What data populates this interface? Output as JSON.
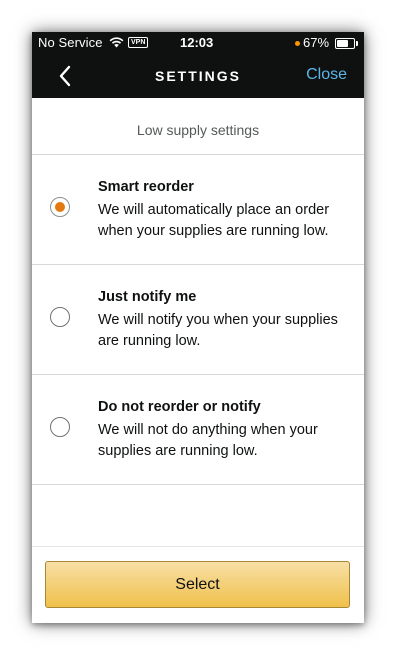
{
  "status_bar": {
    "carrier": "No Service",
    "vpn": "VPN",
    "time": "12:03",
    "battery_percent": "67%",
    "battery_level": 0.67
  },
  "header": {
    "title": "SETTINGS",
    "back_icon": "chevron-left-icon",
    "close_label": "Close"
  },
  "section": {
    "title": "Low supply settings"
  },
  "options": [
    {
      "title": "Smart reorder",
      "description": "We will automatically place an order when your supplies are running low.",
      "selected": true
    },
    {
      "title": "Just notify me",
      "description": "We will notify you when your supplies are running low.",
      "selected": false
    },
    {
      "title": "Do not reorder or notify",
      "description": "We will not do anything when your supplies are running low.",
      "selected": false
    }
  ],
  "footer": {
    "select_label": "Select"
  },
  "colors": {
    "header_bg": "#0f1111",
    "close_link": "#5bb5e8",
    "radio_selected": "#e47911",
    "select_button": "#f0c14b",
    "battery_dot": "#ff9500"
  }
}
